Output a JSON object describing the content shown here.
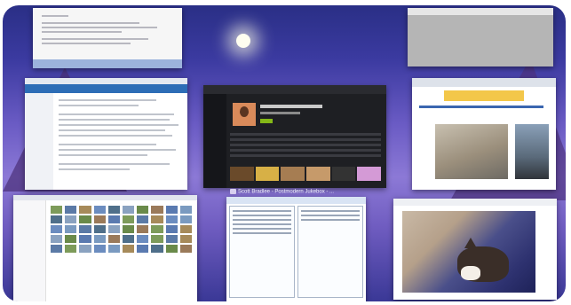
{
  "windows": {
    "document": {
      "caption": ""
    },
    "blank_window": {
      "caption": ""
    },
    "email": {
      "caption": ""
    },
    "music_player": {
      "caption": "Scott Bradlee - Postmodern Jukebox - ...",
      "album_color": "#d98a5a",
      "accent": "#84b817"
    },
    "news_browser": {
      "caption": ""
    },
    "file_explorer": {
      "caption": ""
    },
    "file_manager": {
      "caption": ""
    },
    "photo_viewer": {
      "caption": ""
    }
  },
  "desktop": {
    "moon_glow": "#fffef0",
    "sky_top": "#2a2f86",
    "sky_mid": "#8c79d6"
  }
}
